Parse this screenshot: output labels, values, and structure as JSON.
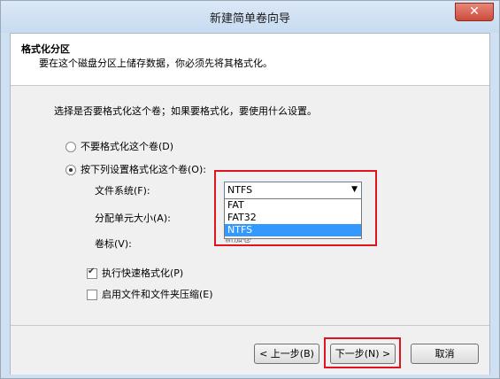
{
  "window": {
    "title": "新建简单卷向导",
    "close_symbol": "✕"
  },
  "header": {
    "title": "格式化分区",
    "subtitle": "要在这个磁盘分区上储存数据，你必须先将其格式化。"
  },
  "main": {
    "instruction": "选择是否要格式化这个卷；如果要格式化，要使用什么设置。",
    "radio_no_format": "不要格式化这个卷(D)",
    "radio_format": "按下列设置格式化这个卷(O):",
    "file_system_label": "文件系统(F):",
    "file_system_value": "NTFS",
    "file_system_options": [
      "FAT",
      "FAT32",
      "NTFS"
    ],
    "allocation_label": "分配单元大小(A):",
    "volume_label_label": "卷标(V):",
    "volume_label_value": "新加卷",
    "quick_format_label": "执行快速格式化(P)",
    "compression_label": "启用文件和文件夹压缩(E)"
  },
  "footer": {
    "back_label": "< 上一步(B)",
    "next_label": "下一步(N) >",
    "cancel_label": "取消"
  },
  "colors": {
    "highlight_red": "#e0141e",
    "selection_blue": "#3399ff"
  }
}
